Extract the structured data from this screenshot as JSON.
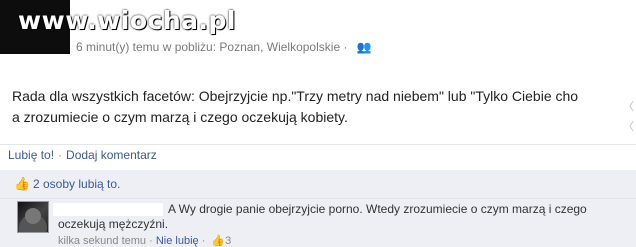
{
  "watermark": {
    "text": "www.wiocha.pl"
  },
  "post": {
    "meta": "6 minut(y) temu w pobliżu: Poznan, Wielkopolskie ·",
    "text_line1": "Rada dla wszystkich facetów: Obejrzyjcie np.\"Trzy metry nad niebem\" lub \"Tylko Ciebie cho",
    "text_line2": "a zrozumiecie o czym marzą i czego oczekują kobiety."
  },
  "actions": {
    "like": "Lubię to!",
    "separator": "·",
    "comment": "Dodaj komentarz"
  },
  "likes": {
    "text": "2 osoby lubią to."
  },
  "comment": {
    "text_line1": "A Wy drogie panie obejrzyjcie porno. Wtedy zrozumiecie o czym marzą i czego",
    "text_line2": "oczekują mężczyźni.",
    "meta_time": "kilka sekund temu",
    "meta_sep": " · ",
    "meta_unlike": "Nie lubię",
    "meta_sep2": " · ",
    "meta_likes_count": "3"
  },
  "icons": {
    "people_icon": "people-icon",
    "thumb_icon": "thumbs-up-icon",
    "arrow_icon": "chevron-icon"
  }
}
